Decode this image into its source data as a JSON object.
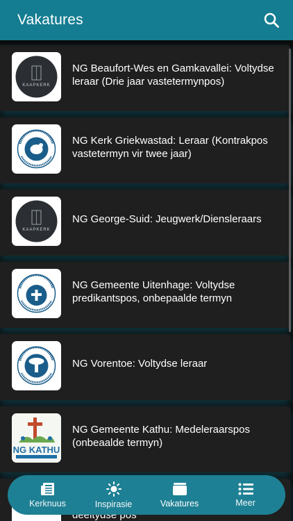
{
  "header": {
    "title": "Vakatures",
    "search_icon": "search-icon"
  },
  "colors": {
    "accent": "#147d91",
    "card": "#1f1f1f",
    "nav": "#1e8094"
  },
  "vacancies": [
    {
      "title": "NG Beaufort-Wes en Gamkavallei: Voltydse leraar (Drie jaar vastetermynpos)",
      "logo": "kaapkerk-logo",
      "logo_text": "KAAPKERK"
    },
    {
      "title": "NG Kerk Griekwastad: Leraar (Kontrakpos vastetermyn vir twee jaar)",
      "logo": "ngk-noord-kaapland-logo",
      "logo_text": "NEDERDUITSE GEREFORMEERDE KERK · IN NOORD-KAAPLAND"
    },
    {
      "title": "NG George-Suid: Jeugwerk/Diensleraars",
      "logo": "kaapkerk-logo",
      "logo_text": "KAAPKERK"
    },
    {
      "title": "NG Gemeente Uitenhage: Voltydse predikantspos, onbepaalde termyn",
      "logo": "ngk-oos-kaapland-logo",
      "logo_text": "NEDERDUITSE GEREFORMEERDE KERK · IN OOS-KAAPLAND"
    },
    {
      "title": "NG Vorentoe: Voltydse leraar",
      "logo": "ngk-noordelike-sinode-logo",
      "logo_text": "NEDERDUITSE GEREFORMEERDE KERK · NOORDELIKE SINODE"
    },
    {
      "title": "NG Gemeente Kathu: Medeleraarspos (onbeaalde termyn)",
      "logo": "ng-kathu-logo",
      "logo_text": "NG KATHU"
    }
  ],
  "peek_item": {
    "text": "deeltydse pos"
  },
  "bottom_nav": [
    {
      "label": "Kerknuus",
      "icon": "newspaper-icon",
      "active": false
    },
    {
      "label": "Inspirasie",
      "icon": "sun-icon",
      "active": false
    },
    {
      "label": "Vakatures",
      "icon": "briefcase-icon",
      "active": true
    },
    {
      "label": "Meer",
      "icon": "list-icon",
      "active": false
    }
  ]
}
